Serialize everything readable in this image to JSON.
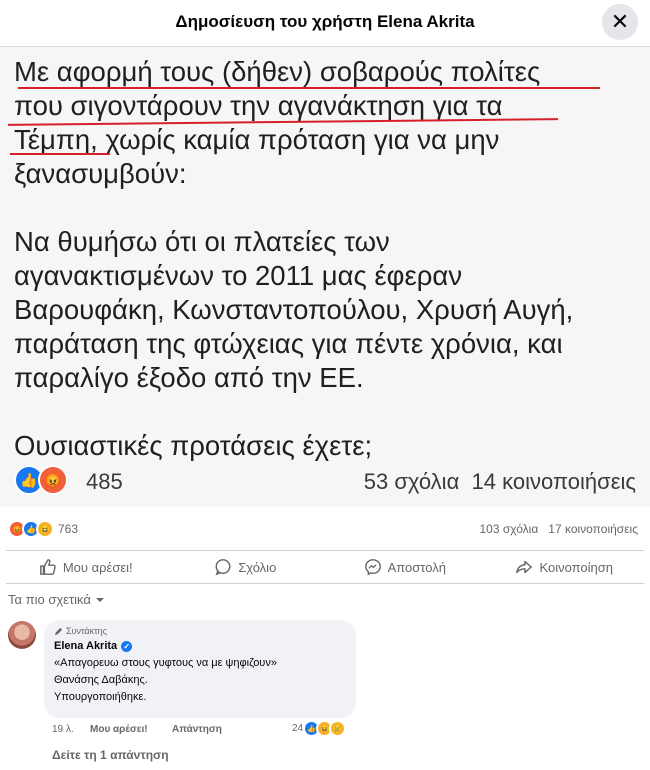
{
  "header": {
    "title": "Δημοσίευση του χρήστη Elena Akrita",
    "close_icon": "close-icon"
  },
  "post_image": {
    "paragraphs": [
      "Με αφορμή τους (δήθεν) σοβαρούς πολίτες\nπου σιγοντάρουν την αγανάκτηση για τα\nΤέμπη, χωρίς καμία πρόταση για να μην\nξανασυμβούν:",
      "Να θυμήσω ότι οι πλατείες των\nαγανακτισμένων  το 2011 μας έφεραν\nΒαρουφάκη, Κωνσταντοπούλου, Χρυσή Αυγή,\nπαράταση της φτώχειας για πέντε χρόνια, και\nπαραλίγο έξοδο από την ΕΕ.",
      "Ουσιαστικές προτάσεις έχετε;"
    ],
    "underline_color": "#d61f2b",
    "stats": {
      "reactions_count": "485",
      "comments": "53 σχόλια",
      "shares": "14 κοινοποιήσεις"
    }
  },
  "stats": {
    "reactions_count": "763",
    "comments": "103 σχόλια",
    "shares": "17 κοινοποιήσεις"
  },
  "actions": [
    {
      "label": "Μου αρέσει!",
      "icon": "thumbs-up-icon"
    },
    {
      "label": "Σχόλιο",
      "icon": "comment-icon"
    },
    {
      "label": "Αποστολή",
      "icon": "messenger-icon"
    },
    {
      "label": "Κοινοποίηση",
      "icon": "share-icon"
    }
  ],
  "sort": {
    "label": "Τα πιο σχετικά"
  },
  "comment": {
    "badge": "Συντάκτης",
    "author": "Elena Akrita",
    "lines": [
      "«Απαγορευω στους γυφτους να με ψηφιζουν»",
      "Θανάσης Δαβάκης.",
      "Υπουργοποιήθηκε."
    ],
    "time": "19 λ.",
    "like_label": "Μου αρέσει!",
    "reply_label": "Απάντηση",
    "reactions_count": "24",
    "view_replies": "Δείτε τη 1 απάντηση"
  },
  "colors": {
    "facebook_blue": "#1877f2",
    "text_secondary": "#65676b",
    "bubble_bg": "#f0f2f5"
  }
}
